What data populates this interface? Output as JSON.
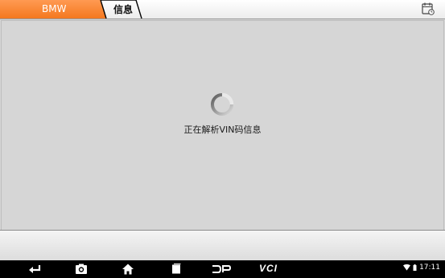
{
  "tabs": [
    {
      "label": "BMW",
      "active": true
    },
    {
      "label": "信息",
      "active": false
    }
  ],
  "toolbar": {
    "right_icon": "calendar-icon"
  },
  "main": {
    "spinner_icon": "loading-spinner-icon",
    "loading_text": "正在解析VIN码信息"
  },
  "navbar": {
    "items": [
      "back-icon",
      "camera-icon",
      "home-icon",
      "recent-apps-icon",
      "dp-icon",
      "vci-icon"
    ],
    "vci_label": "VCI"
  },
  "status": {
    "time": "17:11",
    "icons": [
      "wifi-icon",
      "battery-icon"
    ]
  },
  "colors": {
    "accent": "#f4781f",
    "background": "#d6d6d6",
    "navbar": "#000000"
  }
}
